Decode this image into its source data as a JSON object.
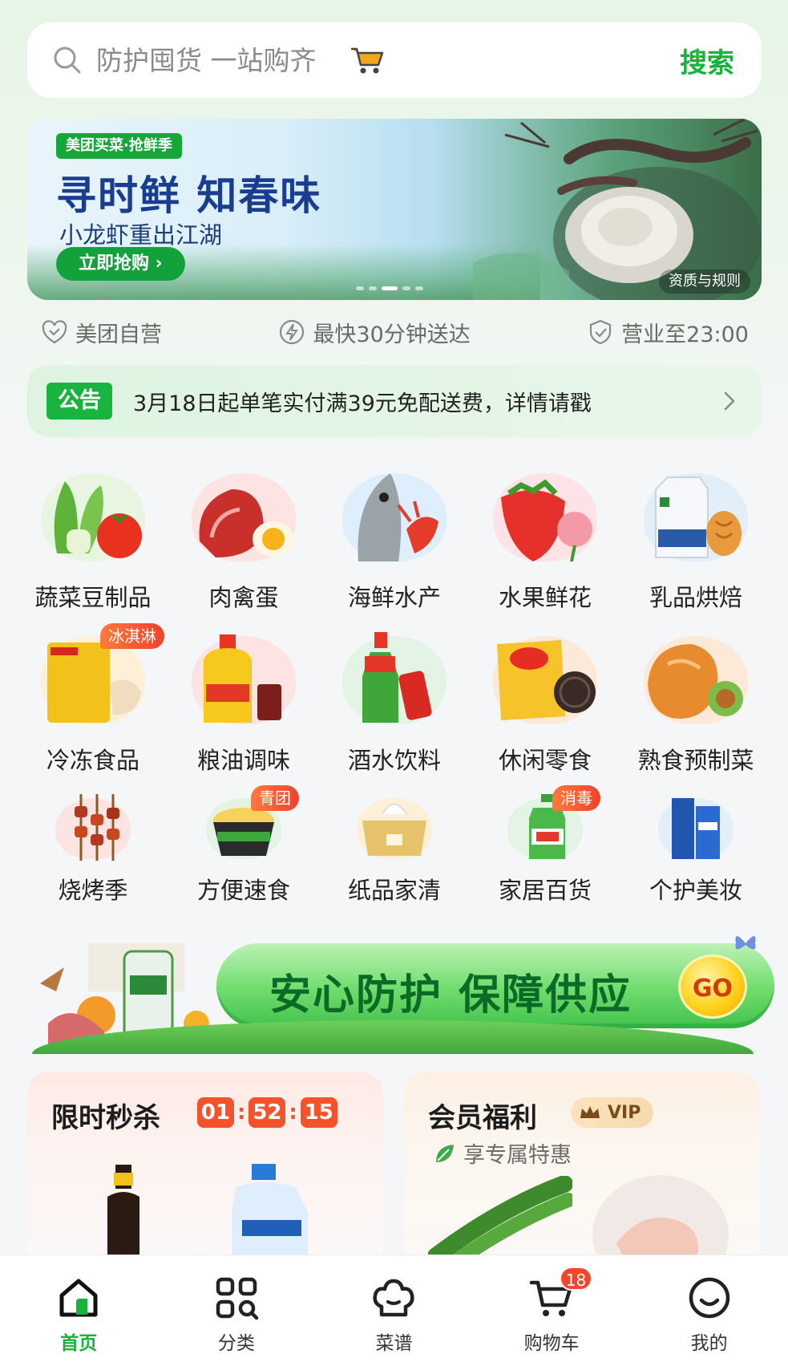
{
  "search": {
    "placeholder": "防护囤货 一站购齐",
    "button_label": "搜索"
  },
  "banner": {
    "tag": "美团买菜·抢鲜季",
    "title": "寻时鲜  知春味",
    "subtitle": "小龙虾重出江湖",
    "cta": "立即抢购 ›",
    "rules": "资质与规则"
  },
  "features": [
    {
      "label": "美团自营",
      "icon": "heart-shield-icon"
    },
    {
      "label": "最快30分钟送达",
      "icon": "lightning-icon"
    },
    {
      "label": "营业至23:00",
      "icon": "shield-check-icon"
    }
  ],
  "notice": {
    "tag": "公告",
    "text": "3月18日起单笔实付满39元免配送费，详情请戳"
  },
  "categories": [
    {
      "label": "蔬菜豆制品",
      "badge": ""
    },
    {
      "label": "肉禽蛋",
      "badge": ""
    },
    {
      "label": "海鲜水产",
      "badge": ""
    },
    {
      "label": "水果鲜花",
      "badge": ""
    },
    {
      "label": "乳品烘焙",
      "badge": ""
    },
    {
      "label": "冷冻食品",
      "badge": "冰淇淋"
    },
    {
      "label": "粮油调味",
      "badge": ""
    },
    {
      "label": "酒水饮料",
      "badge": ""
    },
    {
      "label": "休闲零食",
      "badge": ""
    },
    {
      "label": "熟食预制菜",
      "badge": ""
    },
    {
      "label": "烧烤季",
      "badge": ""
    },
    {
      "label": "方便速食",
      "badge": "青团"
    },
    {
      "label": "纸品家清",
      "badge": ""
    },
    {
      "label": "家居百货",
      "badge": "消毒"
    },
    {
      "label": "个护美妆",
      "badge": ""
    }
  ],
  "promo": {
    "text": "安心防护 保障供应",
    "go": "GO"
  },
  "flash_sale": {
    "title": "限时秒杀",
    "hours": "01",
    "minutes": "52",
    "seconds": "15"
  },
  "member": {
    "title": "会员福利",
    "vip": "VIP",
    "subtitle": "享专属特惠"
  },
  "nav": [
    {
      "label": "首页",
      "icon": "home-icon",
      "active": true
    },
    {
      "label": "分类",
      "icon": "category-icon",
      "active": false
    },
    {
      "label": "菜谱",
      "icon": "chef-hat-icon",
      "active": false
    },
    {
      "label": "购物车",
      "icon": "cart-icon",
      "active": false,
      "badge": "18"
    },
    {
      "label": "我的",
      "icon": "profile-icon",
      "active": false
    }
  ],
  "colors": {
    "brand_green": "#17b33a",
    "accent_red": "#f3522a"
  }
}
